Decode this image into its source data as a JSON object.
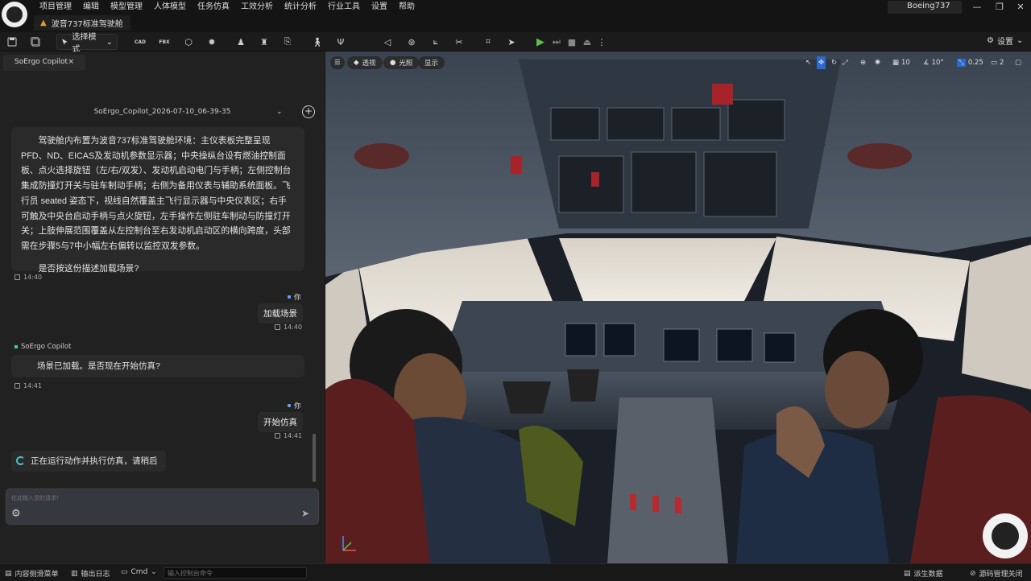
{
  "menu": [
    "项目管理",
    "编辑",
    "模型管理",
    "人体模型",
    "任务仿真",
    "工效分析",
    "统计分析",
    "行业工具",
    "设置",
    "帮助"
  ],
  "document_tab": "波音737标准驾驶舱",
  "project_name": "Boeing737",
  "window_controls": {
    "minimize": "—",
    "restore": "❐",
    "close": "✕"
  },
  "toolbar": {
    "mode_label": "选择模式",
    "settings_label": "设置",
    "icons": [
      "save-icon",
      "save-all-icon",
      "cad-import-icon",
      "fbx-import-icon",
      "cube-icon",
      "light-icon",
      "mannequin-icon",
      "mannequin-pose-icon",
      "export-icon",
      "walk-icon",
      "skeleton-icon",
      "camera-icon",
      "steering-icon",
      "measure-icon",
      "tools-icon",
      "crop-icon",
      "send-icon",
      "play-icon",
      "step-icon",
      "stop-icon",
      "eject-icon",
      "more-icon"
    ]
  },
  "copilot": {
    "tab_label": "SoErgo Copilot",
    "tab_close": "×",
    "session": "SoErgo_Copilot_2026-07-10_06-39-35",
    "bot_name": "SoErgo Copilot",
    "you_label": "你",
    "messages": {
      "m1_p1": "驾驶舱内布置为波音737标准驾驶舱环境：主仪表板完整呈现PFD、ND、EICAS及发动机参数显示器；中央操纵台设有燃油控制面板、点火选择旋钮（左/右/双发）、发动机启动电门与手柄；左侧控制台集成防撞灯开关与驻车制动手柄；右侧为备用仪表与辅助系统面板。飞行员 seated 姿态下，视线自然覆盖主飞行显示器与中央仪表区；右手可触及中央台启动手柄与点火旋钮，左手操作左侧驻车制动与防撞灯开关；上肢伸展范围覆盖从左控制台至右发动机启动区的横向跨度，头部需在步骤5与7中小幅左右偏转以监控双发参数。",
      "m1_p2": "是否按这份描述加载场景?",
      "m1_time": "14:40",
      "u1": "加载场景",
      "u1_time": "14:40",
      "m2": "场景已加载。是否现在开始仿真?",
      "m2_time": "14:41",
      "u2": "开始仿真",
      "u2_time": "14:41",
      "running": "正在运行动作并执行仿真，请稍后"
    },
    "input_placeholder": "在此输入您的请求！"
  },
  "viewport": {
    "view_mode": "透视",
    "lighting": "光照",
    "show": "显示",
    "grid_size": "10",
    "angle_snap": "10°",
    "scale_snap": "0.25",
    "camera_speed": "2"
  },
  "statusbar": {
    "content_drawer": "内容侧滑菜单",
    "output_log": "输出日志",
    "cmd": "Cmd",
    "cmd_placeholder": "输入控制台命令",
    "derived_data": "派生数据",
    "source_control": "源码管理关闭"
  }
}
